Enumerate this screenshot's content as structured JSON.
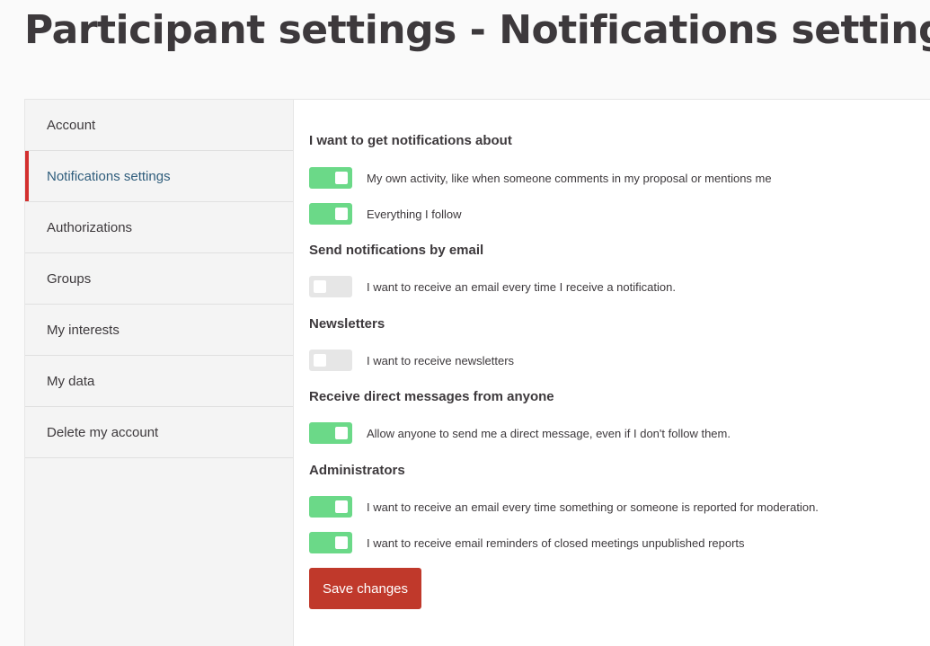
{
  "page": {
    "title": "Participant settings - Notifications settings"
  },
  "sidebar": {
    "items": [
      {
        "label": "Account",
        "active": false
      },
      {
        "label": "Notifications settings",
        "active": true
      },
      {
        "label": "Authorizations",
        "active": false
      },
      {
        "label": "Groups",
        "active": false
      },
      {
        "label": "My interests",
        "active": false
      },
      {
        "label": "My data",
        "active": false
      },
      {
        "label": "Delete my account",
        "active": false
      }
    ]
  },
  "form": {
    "sections": [
      {
        "title": "I want to get notifications about",
        "toggles": [
          {
            "label": "My own activity, like when someone comments in my proposal or mentions me",
            "checked": true
          },
          {
            "label": "Everything I follow",
            "checked": true
          }
        ]
      },
      {
        "title": "Send notifications by email",
        "toggles": [
          {
            "label": "I want to receive an email every time I receive a notification.",
            "checked": false
          }
        ]
      },
      {
        "title": "Newsletters",
        "toggles": [
          {
            "label": "I want to receive newsletters",
            "checked": false
          }
        ]
      },
      {
        "title": "Receive direct messages from anyone",
        "toggles": [
          {
            "label": "Allow anyone to send me a direct message, even if I don't follow them.",
            "checked": true
          }
        ]
      },
      {
        "title": "Administrators",
        "toggles": [
          {
            "label": "I want to receive an email every time something or someone is reported for moderation.",
            "checked": true
          },
          {
            "label": "I want to receive email reminders of closed meetings unpublished reports",
            "checked": true
          }
        ]
      }
    ],
    "save_label": "Save changes"
  },
  "colors": {
    "toggle_on": "#6bd988",
    "toggle_off": "#e6e6e6",
    "accent": "#d3302f",
    "button": "#c0392b"
  }
}
